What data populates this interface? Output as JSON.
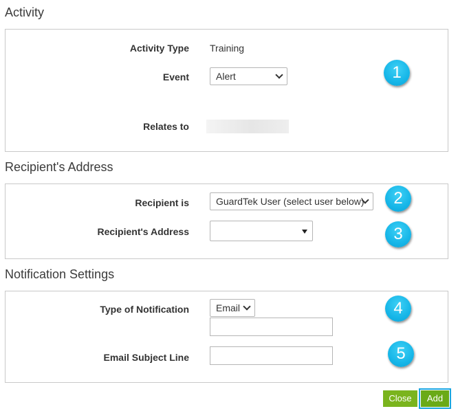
{
  "sections": {
    "activity": {
      "title": "Activity",
      "activity_type_label": "Activity Type",
      "activity_type_value": "Training",
      "event_label": "Event",
      "event_selected": "Alert",
      "relates_to_label": "Relates to"
    },
    "recipient": {
      "title": "Recipient's Address",
      "recipient_is_label": "Recipient is",
      "recipient_is_selected": "GuardTek User (select user below)",
      "recipient_address_label": "Recipient's Address",
      "recipient_address_selected": ""
    },
    "notification": {
      "title": "Notification Settings",
      "type_label": "Type of Notification",
      "type_selected": "Email",
      "email_address_value": "",
      "subject_label": "Email Subject Line",
      "subject_value": ""
    }
  },
  "badges": [
    "1",
    "2",
    "3",
    "4",
    "5"
  ],
  "buttons": {
    "close": "Close",
    "add": "Add"
  },
  "colors": {
    "badge": "#16b6e8",
    "button_green": "#7ab41d",
    "add_highlight": "#1aa6e0"
  }
}
